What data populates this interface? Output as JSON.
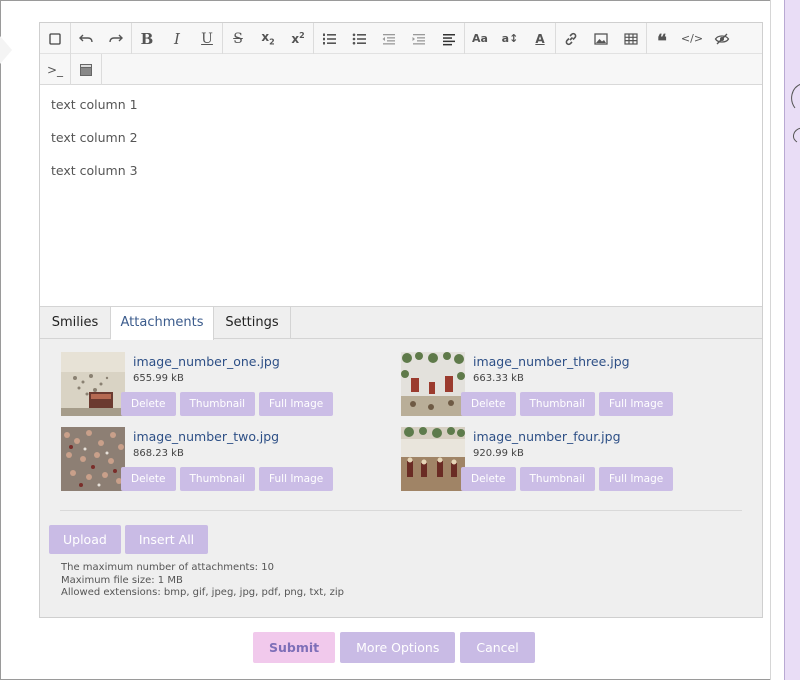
{
  "toolbar": {
    "row1": [
      [
        "checkbox-icon"
      ],
      [
        "undo-icon",
        "redo-icon"
      ],
      [
        "bold-icon",
        "italic-icon",
        "underline-icon"
      ],
      [
        "strikethrough-icon",
        "subscript-icon",
        "superscript-icon"
      ],
      [
        "ordered-list-icon",
        "unordered-list-icon",
        "outdent-icon",
        "indent-icon",
        "align-icon"
      ],
      [
        "font-size-icon",
        "line-height-icon",
        "font-color-icon"
      ],
      [
        "link-icon",
        "image-icon",
        "table-icon"
      ],
      [
        "quote-icon",
        "code-icon",
        "preview-icon"
      ]
    ],
    "row2": [
      "terminal-icon",
      "media-icon"
    ]
  },
  "editor": {
    "lines": [
      "text column 1",
      "text column 2",
      "text column 3"
    ]
  },
  "tabs": [
    {
      "label": "Smilies",
      "active": false
    },
    {
      "label": "Attachments",
      "active": true
    },
    {
      "label": "Settings",
      "active": false
    }
  ],
  "attachments": [
    {
      "name": "image_number_one.jpg",
      "size": "655.99 kB"
    },
    {
      "name": "image_number_three.jpg",
      "size": "663.33 kB"
    },
    {
      "name": "image_number_two.jpg",
      "size": "868.23 kB"
    },
    {
      "name": "image_number_four.jpg",
      "size": "920.99 kB"
    }
  ],
  "attachment_buttons": {
    "delete": "Delete",
    "thumbnail": "Thumbnail",
    "full": "Full Image"
  },
  "upload": {
    "upload_label": "Upload",
    "insert_all_label": "Insert All"
  },
  "limits": {
    "max_count": "The maximum number of attachments: 10",
    "max_size": "Maximum file size: 1 MB",
    "extensions": "Allowed extensions: bmp, gif, jpeg, jpg, pdf, png, txt, zip"
  },
  "actions": {
    "submit": "Submit",
    "more_options": "More Options",
    "cancel": "Cancel"
  },
  "colors": {
    "accent": "#c9bbe5",
    "submit_bg": "#f1c9ec",
    "link": "#2d4f86"
  }
}
